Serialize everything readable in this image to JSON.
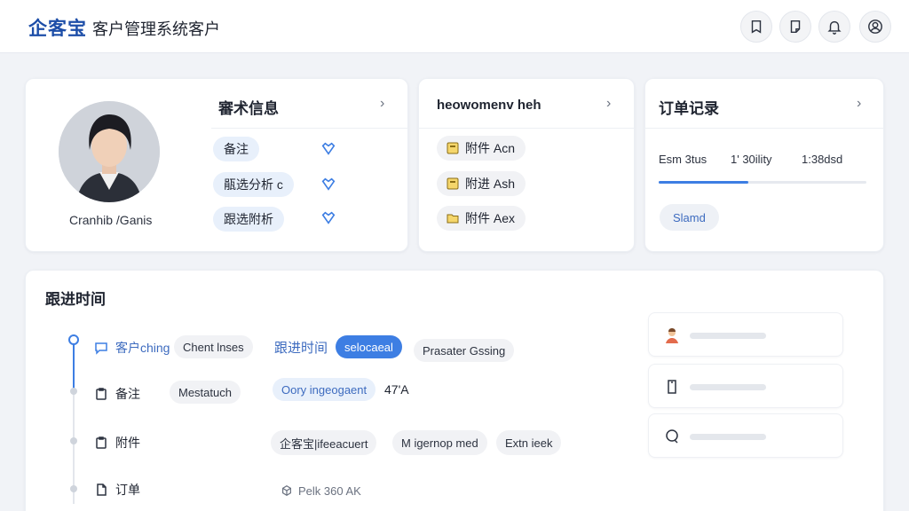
{
  "header": {
    "brand": "企客宝",
    "title": "客户管理系统客户",
    "icons": [
      "bookmark-icon",
      "note-icon",
      "bell-icon",
      "user-icon"
    ]
  },
  "profile_card": {
    "name": "Cranhib /Ganis",
    "title": "審术信息",
    "tags": [
      {
        "label": "备注"
      },
      {
        "label": "瓹选分析 c"
      },
      {
        "label": "跟选附析"
      }
    ]
  },
  "attach_card": {
    "title": "heowomenv heh",
    "items": [
      {
        "label": "附件 Acn"
      },
      {
        "label": "附进 Ash"
      },
      {
        "label": "附件 Aex"
      }
    ]
  },
  "order_card": {
    "title": "订单记录",
    "metrics": [
      "Esm 3tus",
      "1' 30ility",
      "1:38dsd"
    ],
    "progress": 0.43,
    "status": "Slamd"
  },
  "timeline": {
    "title": "跟进时间",
    "rows": [
      {
        "label": "客户ching",
        "chip": "Chent lnses",
        "link": "跟进时间",
        "active_chip": "selocaeal",
        "extra": "Prasater Gssing"
      },
      {
        "label": "备注",
        "chip": "Mestatuch",
        "info_chip": "Oory ingeogaent",
        "value": "47'A"
      },
      {
        "label": "附件",
        "items": [
          "企客宝|ifeeacuert",
          "M igernop med",
          "Extn ieek"
        ]
      },
      {
        "label": "订单",
        "item": "Pelk 360 AK"
      }
    ]
  },
  "colors": {
    "accent": "#3d7ee3",
    "brand": "#1d4ea8"
  }
}
